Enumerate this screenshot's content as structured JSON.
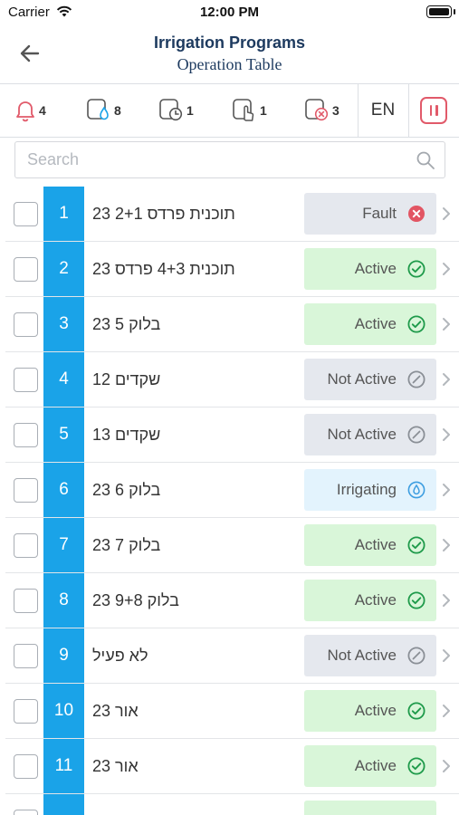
{
  "status_bar": {
    "carrier": "Carrier",
    "time": "12:00 PM"
  },
  "header": {
    "title": "Irrigation Programs",
    "subtitle": "Operation Table"
  },
  "toolbar": {
    "alarms_count": "4",
    "water_count": "8",
    "timer_count": "1",
    "manual_count": "1",
    "stopped_count": "3",
    "language": "EN"
  },
  "search": {
    "placeholder": "Search",
    "value": ""
  },
  "colors": {
    "accent": "#1aa3e8",
    "title": "#1d3a5f",
    "alert": "#e15a6a",
    "status_fault_bg": "#e5e8ee",
    "status_active_bg": "#d9f6d9",
    "status_inactive_bg": "#e5e8ee",
    "status_irrigating_bg": "#e3f3fd",
    "icon_fault": "#e25563",
    "icon_active": "#1e9a4a",
    "icon_inactive": "#8a8f96",
    "icon_irrigating": "#3c9de0"
  },
  "programs": [
    {
      "number": "1",
      "name": "תוכנית פרדס 2+1 23",
      "status": "Fault",
      "status_type": "fault"
    },
    {
      "number": "2",
      "name": "תוכנית 4+3 פרדס 23",
      "status": "Active",
      "status_type": "active"
    },
    {
      "number": "3",
      "name": "בלוק 5 23",
      "status": "Active",
      "status_type": "active"
    },
    {
      "number": "4",
      "name": "שקדים 12",
      "status": "Not Active",
      "status_type": "inactive"
    },
    {
      "number": "5",
      "name": "שקדים 13",
      "status": "Not Active",
      "status_type": "inactive"
    },
    {
      "number": "6",
      "name": "בלוק 6 23",
      "status": "Irrigating",
      "status_type": "irrigating"
    },
    {
      "number": "7",
      "name": "בלוק 7 23",
      "status": "Active",
      "status_type": "active"
    },
    {
      "number": "8",
      "name": "בלוק 9+8 23",
      "status": "Active",
      "status_type": "active"
    },
    {
      "number": "9",
      "name": "לא פעיל",
      "status": "Not Active",
      "status_type": "inactive"
    },
    {
      "number": "10",
      "name": "אור 23",
      "status": "Active",
      "status_type": "active"
    },
    {
      "number": "11",
      "name": "אור 23",
      "status": "Active",
      "status_type": "active"
    },
    {
      "number": "",
      "name": "",
      "status": "",
      "status_type": "active"
    }
  ]
}
